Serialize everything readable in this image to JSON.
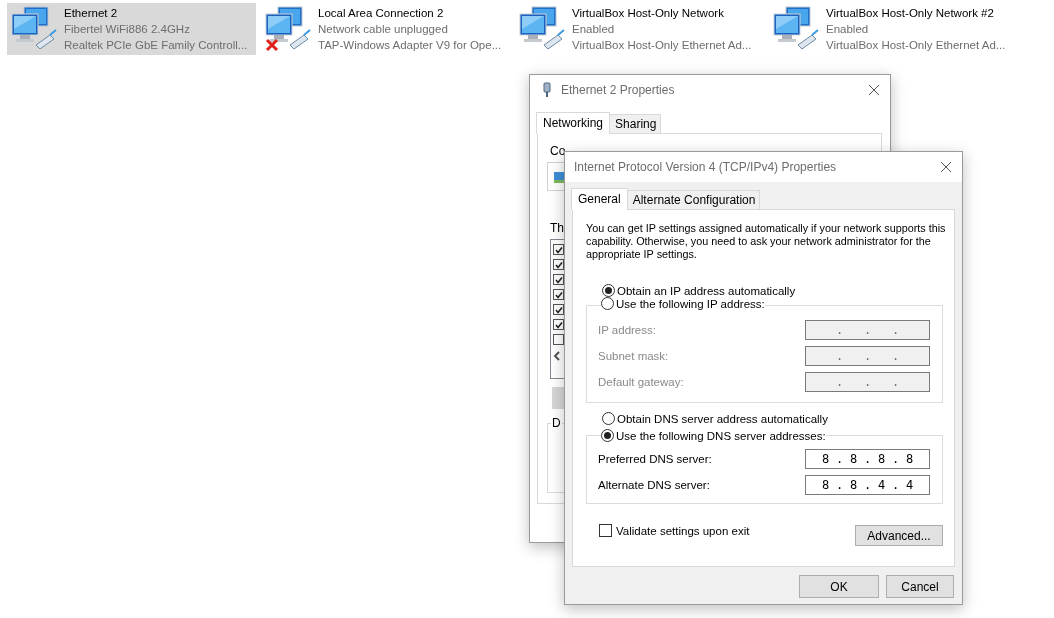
{
  "adapters": [
    {
      "name": "Ethernet 2",
      "status": "Fibertel WiFi886 2.4GHz",
      "device": "Realtek PCIe GbE Family Controll...",
      "selected": true,
      "disconnected": false
    },
    {
      "name": "Local Area Connection 2",
      "status": "Network cable unplugged",
      "device": "TAP-Windows Adapter V9 for Ope...",
      "selected": false,
      "disconnected": true
    },
    {
      "name": "VirtualBox Host-Only Network",
      "status": "Enabled",
      "device": "VirtualBox Host-Only Ethernet Ad...",
      "selected": false,
      "disconnected": false
    },
    {
      "name": "VirtualBox Host-Only Network #2",
      "status": "Enabled",
      "device": "VirtualBox Host-Only Ethernet Ad...",
      "selected": false,
      "disconnected": false
    }
  ],
  "properties_window": {
    "title": "Ethernet 2 Properties",
    "tabs": [
      {
        "label": "Networking",
        "selected": true
      },
      {
        "label": "Sharing",
        "selected": false
      }
    ],
    "connect_label": "Co",
    "components_label": "Th",
    "components": [
      {
        "checked": true
      },
      {
        "checked": true
      },
      {
        "checked": true
      },
      {
        "checked": true
      },
      {
        "checked": true
      },
      {
        "checked": true
      },
      {
        "checked": false
      }
    ],
    "group_label": "D"
  },
  "ipv4_window": {
    "title": "Internet Protocol Version 4 (TCP/IPv4) Properties",
    "tabs": [
      {
        "label": "General",
        "selected": true
      },
      {
        "label": "Alternate Configuration",
        "selected": false
      }
    ],
    "description": "You can get IP settings assigned automatically if your network supports this capability. Otherwise, you need to ask your network administrator for the appropriate IP settings.",
    "separator": ".",
    "ip_options": [
      {
        "label": "Obtain an IP address automatically",
        "selected": true
      },
      {
        "label": "Use the following IP address:",
        "selected": false
      }
    ],
    "ip_fields": [
      {
        "label": "IP address:",
        "disabled": true
      },
      {
        "label": "Subnet mask:",
        "disabled": true
      },
      {
        "label": "Default gateway:",
        "disabled": true
      }
    ],
    "dns_options": [
      {
        "label": "Obtain DNS server address automatically",
        "selected": false
      },
      {
        "label": "Use the following DNS server addresses:",
        "selected": true
      }
    ],
    "dns_fields": [
      {
        "label": "Preferred DNS server:",
        "disabled": false,
        "octets": [
          "8",
          "8",
          "8",
          "8"
        ]
      },
      {
        "label": "Alternate DNS server:",
        "disabled": false,
        "octets": [
          "8",
          "8",
          "4",
          "4"
        ]
      }
    ],
    "validate": {
      "label": "Validate settings upon exit",
      "checked": false
    },
    "advanced_button": "Advanced...",
    "buttons": [
      "OK",
      "Cancel"
    ]
  }
}
